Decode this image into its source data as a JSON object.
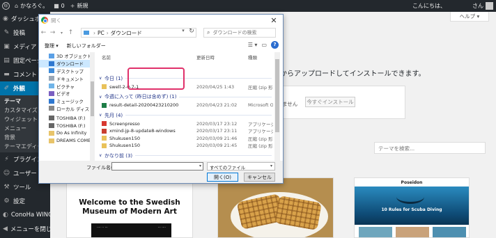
{
  "adminbar": {
    "site_name": "かなろぐ。",
    "comment_count": "0",
    "new_label": "新規",
    "greeting": "こんにちは、",
    "greeting_suffix": "さん"
  },
  "sidebar": {
    "items": [
      {
        "label": "ダッシュボード",
        "icon": "dashboard-icon"
      },
      {
        "label": "投稿",
        "icon": "pin-icon"
      },
      {
        "label": "メディア",
        "icon": "media-icon"
      },
      {
        "label": "固定ページ",
        "icon": "page-icon"
      },
      {
        "label": "コメント",
        "icon": "comment-icon"
      },
      {
        "label": "外観",
        "icon": "brush-icon"
      }
    ],
    "submenu": [
      "テーマ",
      "カスタマイズ",
      "ウィジェット",
      "メニュー",
      "背景",
      "テーマエディター"
    ],
    "items_bottom": [
      {
        "label": "プラグイン",
        "icon": "plugin-icon"
      },
      {
        "label": "ユーザー",
        "icon": "user-icon"
      },
      {
        "label": "ツール",
        "icon": "tool-icon"
      },
      {
        "label": "設定",
        "icon": "settings-icon"
      },
      {
        "label": "ConoHa WING",
        "icon": "conoha-icon"
      },
      {
        "label": "メニューを閉じる",
        "icon": "collapse-icon"
      }
    ]
  },
  "main": {
    "help_label": "ヘルプ ▾",
    "upload_text": "からアップロードしてインストールできます。",
    "no_file_text": "ません",
    "install_button": "今すぐインストール",
    "theme_search_placeholder": "テーマを検索...",
    "themes": {
      "museum_title": "Welcome to the Swedish Museum of Modern Art",
      "poseidon_brand": "Poseidon",
      "poseidon_hero": "10 Rules for Scuba Diving"
    }
  },
  "dialog": {
    "title": "開く",
    "close": "✕",
    "address": {
      "root": "PC",
      "folder": "ダウンロード"
    },
    "search_placeholder": "ダウンロードの検索",
    "toolbar": {
      "organize": "整理 ▾",
      "new_folder": "新しいフォルダー"
    },
    "nav": [
      {
        "label": "3D オブジェクト",
        "color": "#5aa0e6"
      },
      {
        "label": "ダウンロード",
        "color": "#2f78d0",
        "selected": true
      },
      {
        "label": "デスクトップ",
        "color": "#3d8ad8"
      },
      {
        "label": "ドキュメント",
        "color": "#9aa7b6"
      },
      {
        "label": "ピクチャ",
        "color": "#6fb4e8"
      },
      {
        "label": "ビデオ",
        "color": "#7a5fc1"
      },
      {
        "label": "ミュージック",
        "color": "#2f78d0"
      },
      {
        "label": "ローカル ディスク (C",
        "color": "#888888"
      },
      {
        "label": "TOSHIBA (F:)",
        "color": "#666666"
      },
      {
        "label": "TOSHIBA (F:)",
        "color": "#666666"
      },
      {
        "label": "Do As Infinity",
        "color": "#e8c46a"
      },
      {
        "label": "DREAMS COME",
        "color": "#e8c46a"
      }
    ],
    "columns": {
      "name": "名前",
      "date": "更新日時",
      "type": "種類"
    },
    "groups": [
      {
        "label": "今日 (1)",
        "files": [
          {
            "name": "swell-2-0-7-1",
            "date": "2020/04/25 1:43",
            "type": "圧縮 (zip 形",
            "icon": "zip-icon"
          }
        ]
      },
      {
        "label": "今週に入って (昨日は含めず) (1)",
        "files": [
          {
            "name": "result-detail-20200423210200",
            "date": "2020/04/23 21:02",
            "type": "Microsoft O",
            "icon": "excel-icon"
          }
        ]
      },
      {
        "label": "先月 (4)",
        "files": [
          {
            "name": "Screenpresso",
            "date": "2020/03/17 23:12",
            "type": "アプリケーション",
            "icon": "screenpresso-icon"
          },
          {
            "name": "xmind-jp-8-update8-windows",
            "date": "2020/03/17 23:11",
            "type": "アプリケーション",
            "icon": "xmind-icon"
          },
          {
            "name": "Shukusen150",
            "date": "2020/03/09 21:46",
            "type": "圧縮 (zip 形",
            "icon": "zip-icon"
          },
          {
            "name": "Shukusen150",
            "date": "2020/03/09 21:45",
            "type": "圧縮 (zip 形",
            "icon": "zip-icon"
          }
        ]
      },
      {
        "label": "かなり前 (3)",
        "files": []
      }
    ],
    "bottom": {
      "filename_label": "ファイル名(N):",
      "filename_value": "",
      "filetype": "すべてのファイル",
      "open_button": "開く(O)",
      "cancel_button": "キャンセル"
    }
  },
  "colors": {
    "admin_dark": "#23282d",
    "active_blue": "#0073aa",
    "highlight_pink": "#e0306a",
    "group_text": "#1e3287"
  }
}
